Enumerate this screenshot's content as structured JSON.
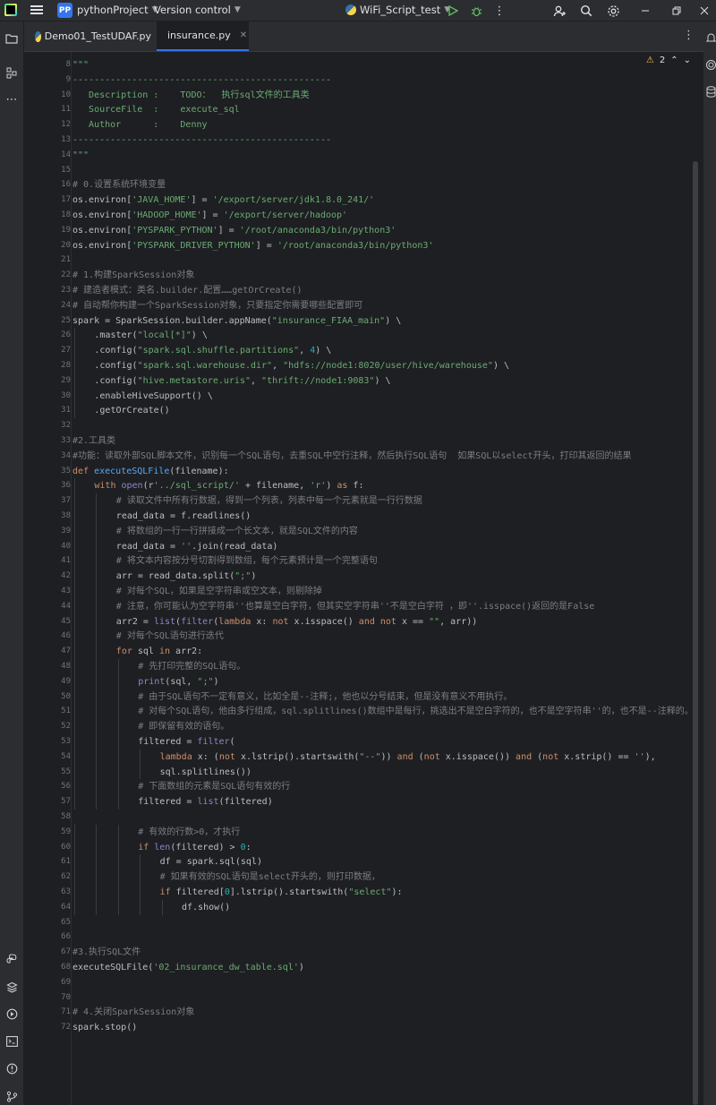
{
  "titlebar": {
    "project_badge": "PP",
    "project_name": "pythonProject",
    "vcs_label": "Version control",
    "run_config": "WiFi_Script_test"
  },
  "tabs": [
    {
      "label": "Demo01_TestUDAF.py",
      "active": false
    },
    {
      "label": "insurance.py",
      "active": true
    }
  ],
  "editor": {
    "inspection_count": "2",
    "lines": [
      {
        "n": "8",
        "indent": 0,
        "tokens": [
          [
            "s",
            "\"\"\""
          ]
        ]
      },
      {
        "n": "9",
        "indent": 0,
        "tokens": [
          [
            "s",
            "------------------------------------------------"
          ]
        ]
      },
      {
        "n": "10",
        "indent": 0,
        "tokens": [
          [
            "s",
            "   Description :    TODO：  执行sql文件的工具类"
          ]
        ]
      },
      {
        "n": "11",
        "indent": 0,
        "tokens": [
          [
            "s",
            "   SourceFile  :    execute_sql"
          ]
        ]
      },
      {
        "n": "12",
        "indent": 0,
        "tokens": [
          [
            "s",
            "   Author      :    Denny"
          ]
        ]
      },
      {
        "n": "13",
        "indent": 0,
        "tokens": [
          [
            "s",
            "------------------------------------------------"
          ]
        ]
      },
      {
        "n": "14",
        "indent": 0,
        "tokens": [
          [
            "s",
            "\"\"\""
          ]
        ]
      },
      {
        "n": "15",
        "indent": 0,
        "tokens": []
      },
      {
        "n": "16",
        "indent": 0,
        "tokens": [
          [
            "c",
            "# 0.设置系统环境变量"
          ]
        ]
      },
      {
        "n": "17",
        "indent": 0,
        "tokens": [
          [
            "t",
            "os.environ["
          ],
          [
            "s",
            "'JAVA_HOME'"
          ],
          [
            "t",
            "] = "
          ],
          [
            "s",
            "'/export/server/jdk1.8.0_241/'"
          ]
        ]
      },
      {
        "n": "18",
        "indent": 0,
        "tokens": [
          [
            "t",
            "os.environ["
          ],
          [
            "s",
            "'HADOOP_HOME'"
          ],
          [
            "t",
            "] = "
          ],
          [
            "s",
            "'/export/server/hadoop'"
          ]
        ]
      },
      {
        "n": "19",
        "indent": 0,
        "tokens": [
          [
            "t",
            "os.environ["
          ],
          [
            "s",
            "'PYSPARK_PYTHON'"
          ],
          [
            "t",
            "] = "
          ],
          [
            "s",
            "'/root/anaconda3/bin/python3'"
          ]
        ]
      },
      {
        "n": "20",
        "indent": 0,
        "tokens": [
          [
            "t",
            "os.environ["
          ],
          [
            "s",
            "'PYSPARK_DRIVER_PYTHON'"
          ],
          [
            "t",
            "] = "
          ],
          [
            "s",
            "'/root/anaconda3/bin/python3'"
          ]
        ]
      },
      {
        "n": "21",
        "indent": 0,
        "tokens": []
      },
      {
        "n": "22",
        "indent": 0,
        "tokens": [
          [
            "c",
            "# 1.构建SparkSession对象"
          ]
        ]
      },
      {
        "n": "23",
        "indent": 0,
        "tokens": [
          [
            "c",
            "# 建造者模式：类名.builder.配置……getOrCreate()"
          ]
        ]
      },
      {
        "n": "24",
        "indent": 0,
        "tokens": [
          [
            "c",
            "# 自动帮你构建一个SparkSession对象，只要指定你需要哪些配置即可"
          ]
        ]
      },
      {
        "n": "25",
        "indent": 0,
        "tokens": [
          [
            "t",
            "spark = SparkSession.builder.appName("
          ],
          [
            "s",
            "\"insurance_FIAA_main\""
          ],
          [
            "t",
            ") \\"
          ]
        ]
      },
      {
        "n": "26",
        "indent": 1,
        "tokens": [
          [
            "t",
            ".master("
          ],
          [
            "s",
            "\"local[*]\""
          ],
          [
            "t",
            ") \\"
          ]
        ]
      },
      {
        "n": "27",
        "indent": 1,
        "tokens": [
          [
            "t",
            ".config("
          ],
          [
            "s",
            "\"spark.sql.shuffle.partitions\""
          ],
          [
            "t",
            ", "
          ],
          [
            "n",
            "4"
          ],
          [
            "t",
            ") \\"
          ]
        ]
      },
      {
        "n": "28",
        "indent": 1,
        "tokens": [
          [
            "t",
            ".config("
          ],
          [
            "s",
            "\"spark.sql.warehouse.dir\""
          ],
          [
            "t",
            ", "
          ],
          [
            "s",
            "\"hdfs://node1:8020/user/hive/warehouse\""
          ],
          [
            "t",
            ") \\"
          ]
        ]
      },
      {
        "n": "29",
        "indent": 1,
        "tokens": [
          [
            "t",
            ".config("
          ],
          [
            "s",
            "\"hive.metastore.uris\""
          ],
          [
            "t",
            ", "
          ],
          [
            "s",
            "\"thrift://node1:9083\""
          ],
          [
            "t",
            ") \\"
          ]
        ]
      },
      {
        "n": "30",
        "indent": 1,
        "tokens": [
          [
            "t",
            ".enableHiveSupport() \\"
          ]
        ]
      },
      {
        "n": "31",
        "indent": 1,
        "tokens": [
          [
            "t",
            ".getOrCreate()"
          ]
        ]
      },
      {
        "n": "32",
        "indent": 0,
        "tokens": []
      },
      {
        "n": "33",
        "indent": 0,
        "tokens": [
          [
            "c",
            "#2.工具类"
          ]
        ]
      },
      {
        "n": "34",
        "indent": 0,
        "tokens": [
          [
            "c",
            "#功能：读取外部SQL脚本文件，识别每一个SQL语句，去重SQL中空行注释，然后执行SQL语句  如果SQL以select开头，打印其返回的结果"
          ]
        ]
      },
      {
        "n": "35",
        "indent": 0,
        "tokens": [
          [
            "k",
            "def "
          ],
          [
            "f",
            "executeSQLFile"
          ],
          [
            "t",
            "(filename):"
          ]
        ]
      },
      {
        "n": "36",
        "indent": 1,
        "tokens": [
          [
            "k",
            "with "
          ],
          [
            "b",
            "open"
          ],
          [
            "t",
            "(r"
          ],
          [
            "s",
            "'../sql_script/'"
          ],
          [
            "t",
            " + filename, "
          ],
          [
            "s",
            "'r'"
          ],
          [
            "t",
            ") "
          ],
          [
            "k",
            "as "
          ],
          [
            "t",
            "f:"
          ]
        ]
      },
      {
        "n": "37",
        "indent": 2,
        "tokens": [
          [
            "c",
            "# 读取文件中所有行数据，得到一个列表，列表中每一个元素就是一行行数据"
          ]
        ]
      },
      {
        "n": "38",
        "indent": 2,
        "tokens": [
          [
            "t",
            "read_data = f.readlines()"
          ]
        ]
      },
      {
        "n": "39",
        "indent": 2,
        "tokens": [
          [
            "c",
            "# 将数组的一行一行拼接成一个长文本，就是SQL文件的内容"
          ]
        ]
      },
      {
        "n": "40",
        "indent": 2,
        "tokens": [
          [
            "t",
            "read_data = "
          ],
          [
            "s",
            "''"
          ],
          [
            "t",
            ".join(read_data)"
          ]
        ]
      },
      {
        "n": "41",
        "indent": 2,
        "tokens": [
          [
            "c",
            "# 将文本内容按分号切割得到数组，每个元素预计是一个完整语句"
          ]
        ]
      },
      {
        "n": "42",
        "indent": 2,
        "tokens": [
          [
            "t",
            "arr = read_data.split("
          ],
          [
            "s",
            "\";\""
          ],
          [
            "t",
            ")"
          ]
        ]
      },
      {
        "n": "43",
        "indent": 2,
        "tokens": [
          [
            "c",
            "# 对每个SQL，如果是空字符串或空文本，则剔除掉"
          ]
        ]
      },
      {
        "n": "44",
        "indent": 2,
        "tokens": [
          [
            "c",
            "# 注意，你可能认为空字符串''也算是空白字符，但其实空字符串''不是空白字符 ，即''.isspace()返回的是False"
          ]
        ]
      },
      {
        "n": "45",
        "indent": 2,
        "tokens": [
          [
            "t",
            "arr2 = "
          ],
          [
            "b",
            "list"
          ],
          [
            "t",
            "("
          ],
          [
            "b",
            "filter"
          ],
          [
            "t",
            "("
          ],
          [
            "k",
            "lambda "
          ],
          [
            "t",
            "x: "
          ],
          [
            "k",
            "not "
          ],
          [
            "t",
            "x.isspace() "
          ],
          [
            "k",
            "and not "
          ],
          [
            "t",
            "x == "
          ],
          [
            "s",
            "\"\""
          ],
          [
            "t",
            ", arr))"
          ]
        ]
      },
      {
        "n": "46",
        "indent": 2,
        "tokens": [
          [
            "c",
            "# 对每个SQL语句进行迭代"
          ]
        ]
      },
      {
        "n": "47",
        "indent": 2,
        "tokens": [
          [
            "k",
            "for "
          ],
          [
            "t",
            "sql "
          ],
          [
            "k",
            "in "
          ],
          [
            "t",
            "arr2:"
          ]
        ]
      },
      {
        "n": "48",
        "indent": 3,
        "tokens": [
          [
            "c",
            "# 先打印完整的SQL语句。"
          ]
        ]
      },
      {
        "n": "49",
        "indent": 3,
        "tokens": [
          [
            "b",
            "print"
          ],
          [
            "t",
            "(sql, "
          ],
          [
            "s",
            "\";\""
          ],
          [
            "t",
            ")"
          ]
        ]
      },
      {
        "n": "50",
        "indent": 3,
        "tokens": [
          [
            "c",
            "# 由于SQL语句不一定有意义，比如全是--注释;，他也以分号结束，但是没有意义不用执行。"
          ]
        ]
      },
      {
        "n": "51",
        "indent": 3,
        "tokens": [
          [
            "c",
            "# 对每个SQL语句，他由多行组成，sql.splitlines()数组中是每行，挑选出不是空白字符的，也不是空字符串''的，也不是--注释的。"
          ]
        ]
      },
      {
        "n": "52",
        "indent": 3,
        "tokens": [
          [
            "c",
            "# 即保留有效的语句。"
          ]
        ]
      },
      {
        "n": "53",
        "indent": 3,
        "tokens": [
          [
            "t",
            "filtered = "
          ],
          [
            "b",
            "filter"
          ],
          [
            "t",
            "("
          ]
        ]
      },
      {
        "n": "54",
        "indent": 4,
        "tokens": [
          [
            "k",
            "lambda "
          ],
          [
            "t",
            "x: ("
          ],
          [
            "k",
            "not "
          ],
          [
            "t",
            "x.lstrip().startswith("
          ],
          [
            "s",
            "\"--\""
          ],
          [
            "t",
            ")) "
          ],
          [
            "k",
            "and "
          ],
          [
            "t",
            "("
          ],
          [
            "k",
            "not "
          ],
          [
            "t",
            "x.isspace()) "
          ],
          [
            "k",
            "and "
          ],
          [
            "t",
            "("
          ],
          [
            "k",
            "not "
          ],
          [
            "t",
            "x.strip() == "
          ],
          [
            "s",
            "''"
          ],
          [
            "t",
            "),"
          ]
        ]
      },
      {
        "n": "55",
        "indent": 4,
        "tokens": [
          [
            "t",
            "sql.splitlines())"
          ]
        ]
      },
      {
        "n": "56",
        "indent": 3,
        "tokens": [
          [
            "c",
            "# 下面数组的元素是SQL语句有效的行"
          ]
        ]
      },
      {
        "n": "57",
        "indent": 3,
        "tokens": [
          [
            "t",
            "filtered = "
          ],
          [
            "b",
            "list"
          ],
          [
            "t",
            "(filtered)"
          ]
        ]
      },
      {
        "n": "58",
        "indent": 0,
        "tokens": []
      },
      {
        "n": "59",
        "indent": 3,
        "tokens": [
          [
            "c",
            "# 有效的行数>0，才执行"
          ]
        ]
      },
      {
        "n": "60",
        "indent": 3,
        "tokens": [
          [
            "k",
            "if "
          ],
          [
            "b",
            "len"
          ],
          [
            "t",
            "(filtered) > "
          ],
          [
            "n",
            "0"
          ],
          [
            "t",
            ":"
          ]
        ]
      },
      {
        "n": "61",
        "indent": 4,
        "tokens": [
          [
            "t",
            "df = spark.sql(sql)"
          ]
        ]
      },
      {
        "n": "62",
        "indent": 4,
        "tokens": [
          [
            "c",
            "# 如果有效的SQL语句是select开头的，则打印数据，"
          ]
        ]
      },
      {
        "n": "63",
        "indent": 4,
        "tokens": [
          [
            "k",
            "if "
          ],
          [
            "t",
            "filtered["
          ],
          [
            "n",
            "0"
          ],
          [
            "t",
            "].lstrip().startswith("
          ],
          [
            "s",
            "\"select\""
          ],
          [
            "t",
            "):"
          ]
        ]
      },
      {
        "n": "64",
        "indent": 5,
        "tokens": [
          [
            "t",
            "df.show()"
          ]
        ]
      },
      {
        "n": "65",
        "indent": 0,
        "tokens": []
      },
      {
        "n": "66",
        "indent": 0,
        "tokens": []
      },
      {
        "n": "67",
        "indent": 0,
        "tokens": [
          [
            "c",
            "#3.执行SQL文件"
          ]
        ]
      },
      {
        "n": "68",
        "indent": 0,
        "tokens": [
          [
            "t",
            "executeSQLFile("
          ],
          [
            "s",
            "'02_insurance_dw_table.sql'"
          ],
          [
            "t",
            ")"
          ]
        ]
      },
      {
        "n": "69",
        "indent": 0,
        "tokens": []
      },
      {
        "n": "70",
        "indent": 0,
        "tokens": []
      },
      {
        "n": "71",
        "indent": 0,
        "tokens": [
          [
            "c",
            "# 4.关闭SparkSession对象"
          ]
        ]
      },
      {
        "n": "72",
        "indent": 0,
        "tokens": [
          [
            "t",
            "spark.stop()"
          ]
        ]
      }
    ]
  },
  "icons": {
    "titlebar": [
      "app-logo-icon",
      "main-menu-icon",
      "chevron-down-icon",
      "python-icon",
      "run-icon",
      "debug-icon",
      "more-vertical-icon",
      "add-user-icon",
      "search-icon",
      "settings-icon",
      "minimize-icon",
      "restore-icon",
      "close-icon"
    ],
    "leftbar": [
      "project-folder-icon",
      "structure-icon",
      "more-horizontal-icon",
      "python-console-icon",
      "layers-icon",
      "services-run-icon",
      "terminal-icon",
      "problems-icon",
      "git-icon"
    ],
    "rightbar": [
      "notifications-icon",
      "ai-assistant-icon",
      "database-icon"
    ]
  },
  "colors": {
    "accent": "#3574f0",
    "keyword": "#cf8e6d",
    "string": "#6aab73",
    "comment": "#7a7e85",
    "number": "#2aacb8",
    "function": "#56a8f5",
    "builtin": "#8888c6",
    "warning": "#f2c55c"
  }
}
